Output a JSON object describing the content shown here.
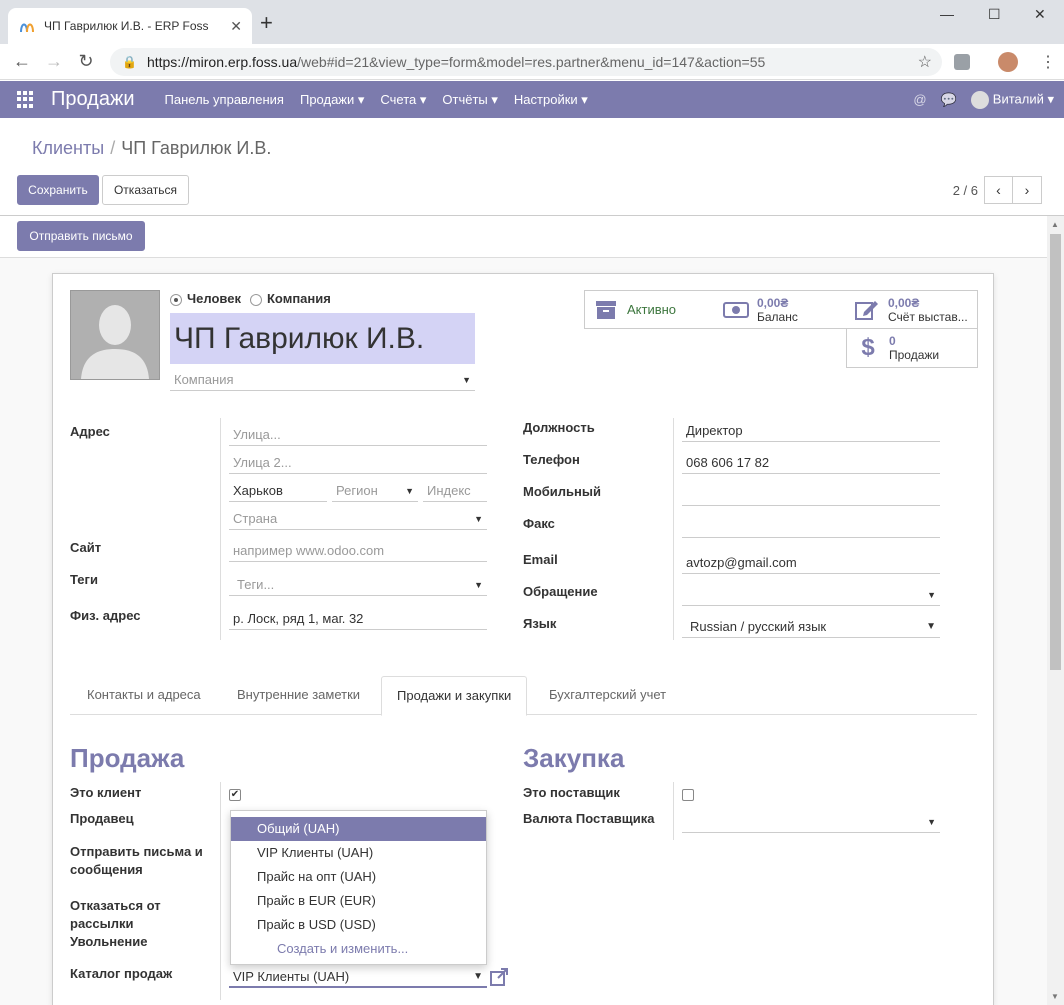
{
  "browser": {
    "tab_title": "ЧП Гаврилюк И.В. - ERP Foss",
    "url_host": "https://miron.erp.foss.ua",
    "url_path": "/web#id=21&view_type=form&model=res.partner&menu_id=147&action=55"
  },
  "navbar": {
    "brand": "Продажи",
    "menus": [
      "Панель управления",
      "Продажи ▾",
      "Счета ▾",
      "Отчёты ▾",
      "Настройки ▾"
    ],
    "user": "Виталий ▾"
  },
  "breadcrumb": {
    "parent": "Клиенты",
    "sep": "/",
    "current": "ЧП Гаврилюк И.В."
  },
  "buttons": {
    "save": "Сохранить",
    "discard": "Отказаться",
    "send_mail": "Отправить письмо"
  },
  "pager": {
    "value": "2 / 6"
  },
  "partner": {
    "type_person": "Человек",
    "type_company": "Компания",
    "name": "ЧП Гаврилюк И.В.",
    "company_placeholder": "Компания"
  },
  "smart_buttons": {
    "active": "Активно",
    "balance_value": "0,00₴",
    "balance_label": "Баланс",
    "invoiced_value": "0,00₴",
    "invoiced_label": "Счёт выстав...",
    "sales_value": "0",
    "sales_label": "Продажи"
  },
  "left_fields": {
    "address_label": "Адрес",
    "street_ph": "Улица...",
    "street2_ph": "Улица 2...",
    "city": "Харьков",
    "region_ph": "Регион",
    "zip_ph": "Индекс",
    "country_ph": "Страна",
    "site_label": "Сайт",
    "site_ph": "например www.odoo.com",
    "tags_label": "Теги",
    "tags_ph": "Теги...",
    "phys_label": "Физ. адрес",
    "phys_value": "р. Лоск, ряд 1, маг. 32"
  },
  "right_fields": {
    "position_label": "Должность",
    "position_value": "Директор",
    "phone_label": "Телефон",
    "phone_value": "068 606 17 82",
    "mobile_label": "Мобильный",
    "fax_label": "Факс",
    "email_label": "Email",
    "email_value": "avtozp@gmail.com",
    "title_label": "Обращение",
    "lang_label": "Язык",
    "lang_value": "Russian / русский язык"
  },
  "tabs": [
    "Контакты и адреса",
    "Внутренние заметки",
    "Продажи и закупки",
    "Бухгалтерский учет"
  ],
  "sales": {
    "heading": "Продажа",
    "is_customer": "Это клиент",
    "salesperson": "Продавец",
    "send_messages": "Отправить письма и сообщения",
    "optout": "Отказаться от рассылки Увольнение",
    "pricelist": "Каталог продаж",
    "pricelist_value": "VIP Клиенты (UAH)"
  },
  "purchase": {
    "heading": "Закупка",
    "is_supplier": "Это поставщик",
    "supplier_currency": "Валюта Поставщика"
  },
  "pricelist_dropdown": {
    "options": [
      "Общий (UAH)",
      "VIP Клиенты (UAH)",
      "Прайс на опт (UAH)",
      "Прайс в EUR (EUR)",
      "Прайс в USD (USD)"
    ],
    "create": "Создать и изменить..."
  },
  "colors": {
    "accent": "#7c7bad",
    "name_highlight": "#d4d3f5",
    "active_green": "#3c763d"
  }
}
